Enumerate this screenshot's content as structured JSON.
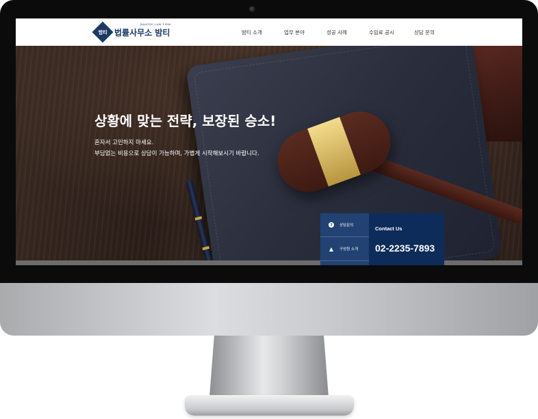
{
  "brand": {
    "subtitle": "BAMTEE LAW FIRM",
    "name": "법률사무소 밤티",
    "mark_text": "밤티",
    "color": "#1d3a64"
  },
  "nav": {
    "items": [
      "밤티 소개",
      "업무 분야",
      "성공 사례",
      "수임료 공시",
      "상담 문의"
    ]
  },
  "hero": {
    "title": "상황에 맞는 전략, 보장된 승소!",
    "line1": "혼자서 고민하지 마세요.",
    "line2": "부담없는 비용으로 상담이 가능하며, 가볍게 시작해보시기 바랍니다."
  },
  "quick_menu": {
    "items": [
      {
        "label": "상담문의",
        "icon": "question-icon"
      },
      {
        "label": "구성원 소개",
        "icon": "people-icon"
      }
    ],
    "color": "#214272"
  },
  "contact": {
    "title": "Contact Us",
    "phone": "02-2235-7893",
    "color": "#0e2c5a"
  }
}
